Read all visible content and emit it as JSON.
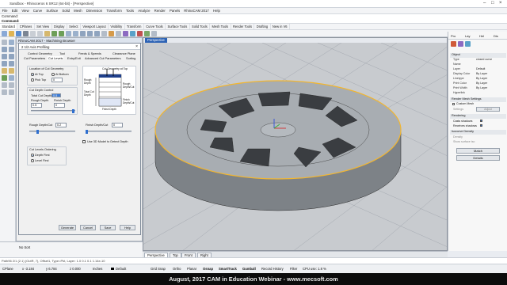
{
  "window": {
    "title": "Sandbox - Rhinoceros 6 SR12 (64-bit) - [Perspective]"
  },
  "menu": [
    "File",
    "Edit",
    "View",
    "Curve",
    "Surface",
    "Solid",
    "Mesh",
    "Dimension",
    "Transform",
    "Tools",
    "Analyze",
    "Render",
    "Panels",
    "RhinoCAM 2017",
    "Help"
  ],
  "command": {
    "line1": "Command:",
    "line2": "Command:"
  },
  "toolbar_tabs": [
    "Standard",
    "CPlanes",
    "Set View",
    "Display",
    "Select",
    "Viewport Layout",
    "Visibility",
    "Transform",
    "Curve Tools",
    "Surface Tools",
    "Solid Tools",
    "Mesh Tools",
    "Render Tools",
    "Drafting",
    "New in V6"
  ],
  "browser": {
    "title": "RhinoCAM 2017 - Machining Browser"
  },
  "dialog": {
    "title": "2 1/2 Axis Profiling",
    "tabs_row1": [
      "Control Geometry",
      "Tool",
      "Feeds & Speeds",
      "Clearance Plane"
    ],
    "tabs_row2": [
      "Cut Parameters",
      "Cut Levels",
      "Entry/Exit",
      "Advanced Cut Parameters",
      "Sorting"
    ],
    "location": {
      "label": "Location of Cut Geometry",
      "at_top": "At Top",
      "at_bottom": "At Bottom",
      "pick_top_label": "Pick Top",
      "pick_top_value": "0"
    },
    "depth_control": {
      "label": "Cut Depth Control",
      "total_label": "Total Cut Depth",
      "total_value": "0.5",
      "rough_label": "Rough Depth",
      "rough_value": "0.5",
      "finish_label": "Finish Depth",
      "finish_value": "0"
    },
    "diagram": {
      "title": "Cut Geometry at Top",
      "rough": "Rough Depth",
      "total": "Total Cut Depth",
      "finish": "Finish Depth",
      "rough_cut": "Rough Depth/Cut",
      "finish_cut": "Finish Depth/Cut"
    },
    "per_cut": {
      "rough_label": "Rough Depth/Cut",
      "rough_value": "0.2",
      "finish_label": "Finish Depth/Cut",
      "finish_value": "0"
    },
    "use3d": "Use 3D Model to Detect Depth",
    "ordering": {
      "label": "Cut Levels Ordering",
      "depth_first": "Depth First",
      "level_first": "Level First"
    },
    "buttons": [
      "Generate",
      "Cancel",
      "Save",
      "Help"
    ]
  },
  "viewport": {
    "name": "Perspective"
  },
  "viewport_tabs": [
    "Perspective",
    "Top",
    "Front",
    "Right"
  ],
  "properties": {
    "tabs": [
      "Pro",
      "Lay",
      "Hel",
      "Dis"
    ],
    "section_object": "Object",
    "rows": [
      {
        "k": "Type",
        "v": "closed curve"
      },
      {
        "k": "Name",
        "v": ""
      },
      {
        "k": "Layer",
        "v": "Default"
      },
      {
        "k": "Display Color",
        "v": "By Layer"
      },
      {
        "k": "Linetype",
        "v": "By Layer"
      },
      {
        "k": "Print Color",
        "v": "By Layer"
      },
      {
        "k": "Print Width",
        "v": "By Layer"
      },
      {
        "k": "Hyperlink",
        "v": ""
      }
    ],
    "section_render": "Render Mesh Settings",
    "custom_mesh": "Custom Mesh",
    "settings_label": "Settings",
    "settings_btn": "Adjust",
    "section_rendering": "Rendering",
    "casts": "Casts shadows",
    "receives": "Receives shadows",
    "section_isocurve": "Isocurve Density",
    "density": "Density",
    "show_iso": "Show surface iso",
    "match": "Match",
    "details": "Details"
  },
  "osnap_label": "No Sort",
  "cmdline": "Path96 2/1 (2.1) (OutR, 7), Offset1, Type=Pkt, Layer: 1.0 0.1 0.1 1.14e-10",
  "status": {
    "cplane": "CPlane",
    "x": "x -3.184",
    "y": "y 6.784",
    "z": "z 0.000",
    "units": "Inches",
    "layer": "Default",
    "grid": "Grid Snap",
    "ortho": "Ortho",
    "planar": "Planar",
    "osnap": "Osnap",
    "smarttrack": "SmartTrack",
    "gumball": "Gumball",
    "history": "Record History",
    "filter": "Filter",
    "cpu": "CPU use: 1.8 %"
  },
  "banner": "August, 2017 CAM in Education Webinar - www.mecsoft.com",
  "colors": {
    "accent": "#2d63b5",
    "model_highlight": "#f2b630",
    "banner_bg": "#0c0c0c"
  }
}
